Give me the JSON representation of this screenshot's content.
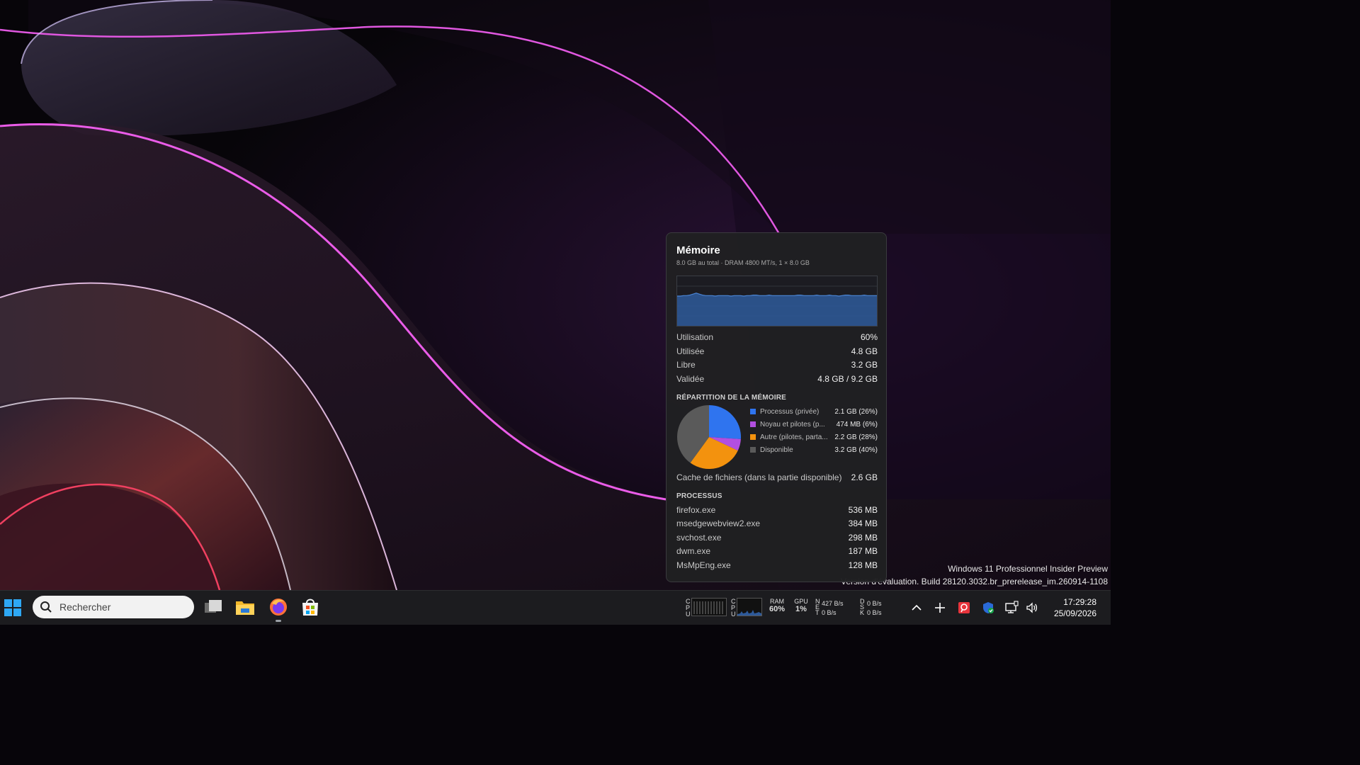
{
  "memory": {
    "title": "Mémoire",
    "subtitle": "8.0 GB au total · DRAM 4800 MT/s, 1 × 8.0 GB",
    "usage_history_percent": [
      60,
      60,
      61,
      61,
      62,
      64,
      66,
      64,
      62,
      61,
      61,
      61,
      60,
      61,
      61,
      61,
      61,
      60,
      61,
      61,
      61,
      60,
      61,
      61,
      62,
      62,
      61,
      61,
      61,
      62,
      61,
      61,
      61,
      61,
      61,
      61,
      61,
      61,
      62,
      62,
      61,
      61,
      61,
      61,
      62,
      61,
      61,
      61,
      62,
      61,
      61,
      60,
      61,
      62,
      62,
      61,
      61,
      61,
      61,
      62,
      61,
      61,
      61,
      61
    ],
    "stats": [
      {
        "label": "Utilisation",
        "value": "60%"
      },
      {
        "label": "Utilisée",
        "value": "4.8 GB"
      },
      {
        "label": "Libre",
        "value": "3.2 GB"
      },
      {
        "label": "Validée",
        "value": "4.8 GB / 9.2 GB"
      }
    ],
    "breakdown_title": "RÉPARTITION DE LA MÉMOIRE",
    "breakdown": [
      {
        "label": "Processus (privée)",
        "value": "2.1 GB (26%)",
        "percent": 26,
        "color": "#2f74ef"
      },
      {
        "label": "Noyau et pilotes (p...",
        "value": "474 MB (6%)",
        "percent": 6,
        "color": "#b24fe0"
      },
      {
        "label": "Autre (pilotes, parta...",
        "value": "2.2 GB (28%)",
        "percent": 28,
        "color": "#f3920e"
      },
      {
        "label": "Disponible",
        "value": "3.2 GB (40%)",
        "percent": 40,
        "color": "#5a5a5a"
      }
    ],
    "cache": {
      "label": "Cache de fichiers (dans la partie disponible)",
      "value": "2.6 GB"
    },
    "processes_title": "PROCESSUS",
    "processes": [
      {
        "name": "firefox.exe",
        "value": "536 MB"
      },
      {
        "name": "msedgewebview2.exe",
        "value": "384 MB"
      },
      {
        "name": "svchost.exe",
        "value": "298 MB"
      },
      {
        "name": "dwm.exe",
        "value": "187 MB"
      },
      {
        "name": "MsMpEng.exe",
        "value": "128 MB"
      }
    ]
  },
  "watermark": {
    "line1": "Windows 11 Professionnel Insider Preview",
    "line2": "Version d'évaluation. Build 28120.3032.br_prerelease_im.260914-1108"
  },
  "taskbar": {
    "search_placeholder": "Rechercher",
    "apps": [
      "task-view",
      "file-explorer",
      "firefox",
      "microsoft-store"
    ],
    "widgets": {
      "cpu_label": "C P U",
      "ram_label": "RAM",
      "ram_value": "60%",
      "gpu_label": "GPU",
      "gpu_value": "1%",
      "net_label": "N E T",
      "net_down": "427 B/s",
      "net_up": "0 B/s",
      "disk_label": "D S K",
      "disk_read": "0 B/s",
      "disk_write": "0 B/s"
    },
    "time": "17:29:28",
    "date": "25/09/2026"
  },
  "colors": {
    "accent_pink": "#e84ae6",
    "graph_fill": "#2e5a9a",
    "graph_line": "#4a84d4"
  }
}
